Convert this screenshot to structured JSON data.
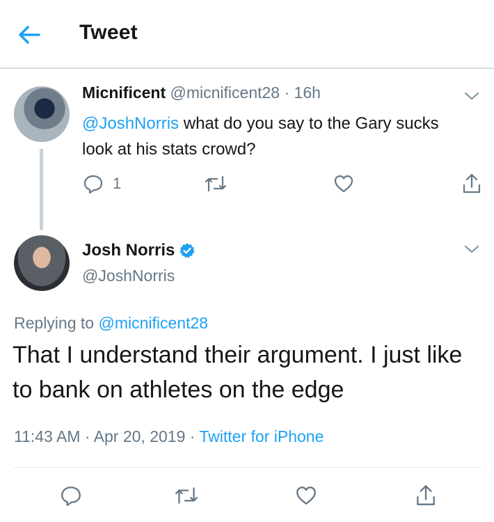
{
  "header": {
    "title": "Tweet"
  },
  "parent_tweet": {
    "name": "Micnificent",
    "handle": "@micnificent28",
    "separator": "·",
    "time": "16h",
    "mention": "@JoshNorris",
    "text": " what do you say to the Gary sucks look at his stats crowd?",
    "reply_count": "1"
  },
  "main_tweet": {
    "name": "Josh Norris",
    "handle": "@JoshNorris",
    "replying_prefix": "Replying to ",
    "replying_handle": "@micnificent28",
    "text": "That I understand their argument. I just like to bank on athletes on the edge",
    "time": "11:43 AM",
    "sep1": " · ",
    "date": "Apr 20, 2019",
    "sep2": " · ",
    "source": "Twitter for iPhone"
  },
  "colors": {
    "accent": "#1da1f2",
    "secondary_text": "#657786",
    "primary_text": "#14171a"
  }
}
